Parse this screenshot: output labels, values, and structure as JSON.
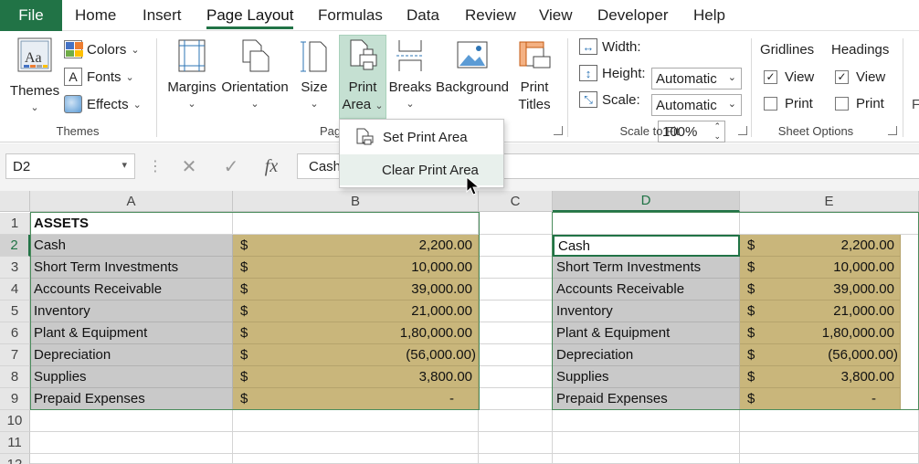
{
  "tabs": {
    "file": "File",
    "items": [
      "Home",
      "Insert",
      "Page Layout",
      "Formulas",
      "Data",
      "Review",
      "View",
      "Developer",
      "Help"
    ],
    "active": "Page Layout"
  },
  "ribbon": {
    "themes": {
      "themes_label": "Themes",
      "colors_label": "Colors",
      "fonts_label": "Fonts",
      "effects_label": "Effects",
      "group_label": "Themes"
    },
    "page_setup": {
      "margins": "Margins",
      "orientation": "Orientation",
      "size": "Size",
      "print_area_line1": "Print",
      "print_area_line2": "Area",
      "breaks": "Breaks",
      "background": "Background",
      "print_titles_line1": "Print",
      "print_titles_line2": "Titles",
      "group_label_partial": "Pag"
    },
    "scale_to_fit": {
      "width_label": "Width:",
      "width_value": "Automatic",
      "height_label": "Height:",
      "height_value": "Automatic",
      "scale_label": "Scale:",
      "scale_value": "100%",
      "group_label": "Scale to Fit"
    },
    "sheet_options": {
      "gridlines": "Gridlines",
      "headings": "Headings",
      "view": "View",
      "print": "Print",
      "gridlines_view_checked": true,
      "headings_view_checked": true,
      "group_label": "Sheet Options",
      "cut_label": "F"
    }
  },
  "menu": {
    "set_print_area": "Set Print Area",
    "clear_print_area": "Clear Print Area"
  },
  "formula_bar": {
    "name_box": "D2",
    "fx": "fx",
    "value": "Cash"
  },
  "grid": {
    "columns": [
      "A",
      "B",
      "C",
      "D",
      "E"
    ],
    "rows": [
      "1",
      "2",
      "3",
      "4",
      "5",
      "6",
      "7",
      "8",
      "9",
      "10",
      "11",
      "12"
    ],
    "header": "ASSETS",
    "currency": "$",
    "items": [
      {
        "label": "Cash",
        "amount": "2,200.00"
      },
      {
        "label": "Short Term Investments",
        "amount": "10,000.00"
      },
      {
        "label": "Accounts Receivable",
        "amount": "39,000.00"
      },
      {
        "label": "Inventory",
        "amount": "21,000.00"
      },
      {
        "label": "Plant & Equipment",
        "amount": "1,80,000.00"
      },
      {
        "label": "Depreciation",
        "amount": "(56,000.00)"
      },
      {
        "label": "Supplies",
        "amount": "3,800.00"
      },
      {
        "label": "Prepaid Expenses",
        "amount": "-"
      }
    ]
  },
  "colors": {
    "accent": "#217346",
    "label_fill": "#c9c9c9",
    "amount_fill": "#c9b67b"
  }
}
